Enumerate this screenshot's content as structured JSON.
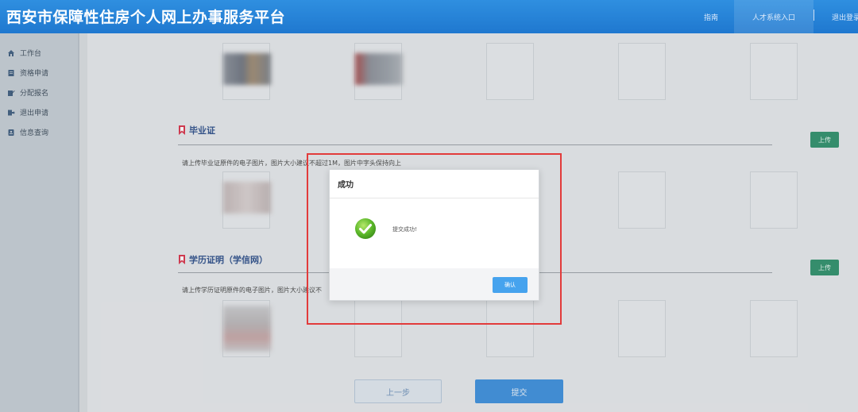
{
  "header": {
    "title": "西安市保障性住房个人网上办事服务平台",
    "nav_help": "指南",
    "nav_talent": "人才系统入口",
    "nav_logout": "退出登录"
  },
  "sidebar": {
    "items": [
      {
        "label": "工作台",
        "icon": "home-icon"
      },
      {
        "label": "资格申请",
        "icon": "document-icon"
      },
      {
        "label": "分配报名",
        "icon": "edit-icon"
      },
      {
        "label": "退出申请",
        "icon": "exit-icon"
      },
      {
        "label": "信息查询",
        "icon": "info-icon"
      }
    ]
  },
  "main": {
    "section_graduation": {
      "title": "毕业证",
      "hint": "请上传毕业证原件的电子图片，图片大小建议不超过1M，图片中字头保持向上",
      "upload_label": "上传"
    },
    "section_education": {
      "title": "学历证明（学信网）",
      "hint": "请上传学历证明原件的电子图片，图片大小建议不",
      "upload_label": "上传"
    },
    "prev_label": "上一步",
    "submit_label": "提交"
  },
  "modal": {
    "title": "成功",
    "message": "提交成功!",
    "ok_label": "确认"
  },
  "colors": {
    "header_blue": "#1f78cf",
    "upload_green": "#2e8f6a",
    "highlight_red": "#e23b3b",
    "ok_blue": "#46a3ee",
    "success_green": "#5cb82a"
  }
}
